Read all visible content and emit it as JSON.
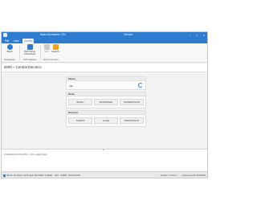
{
  "titlebar": {
    "doc_title": "Basic information / EN",
    "app_title": "iService",
    "min": "–",
    "max": "□",
    "close": "×"
  },
  "tabs": {
    "file": "File",
    "main": "Main",
    "control": "Control"
  },
  "ribbon": {
    "back": "Back",
    "fw": "FW Online Download",
    "edit": "Edit",
    "search": "Search",
    "group_navigation": "Navigation",
    "group_fw": "FW Updates",
    "group_ecu": "ECU Function"
  },
  "page": {
    "title": "0000 – Central Electrics"
  },
  "panels": {
    "status_header": "Status",
    "status_value": "Idle",
    "mode_header": "Mode",
    "mode_options": [
      "BASIC",
      "EXTENDED",
      "SUPERVISOR"
    ],
    "duration_header": "Duration",
    "duration_options": [
      "SHORT",
      "LONG",
      "PERSISTENT"
    ]
  },
  "log": {
    "line": "3/11/2023 10:47:19 PM – 1.0 is output here"
  },
  "statusbar": {
    "left": "Client: 01   Client: 10   Project: BLUSB 0.1 (M01) · S01 · CMMT_SC/ASCON",
    "version": "Version: 1.21.0.1",
    "license": "Licensed until: 8/1/2024"
  }
}
